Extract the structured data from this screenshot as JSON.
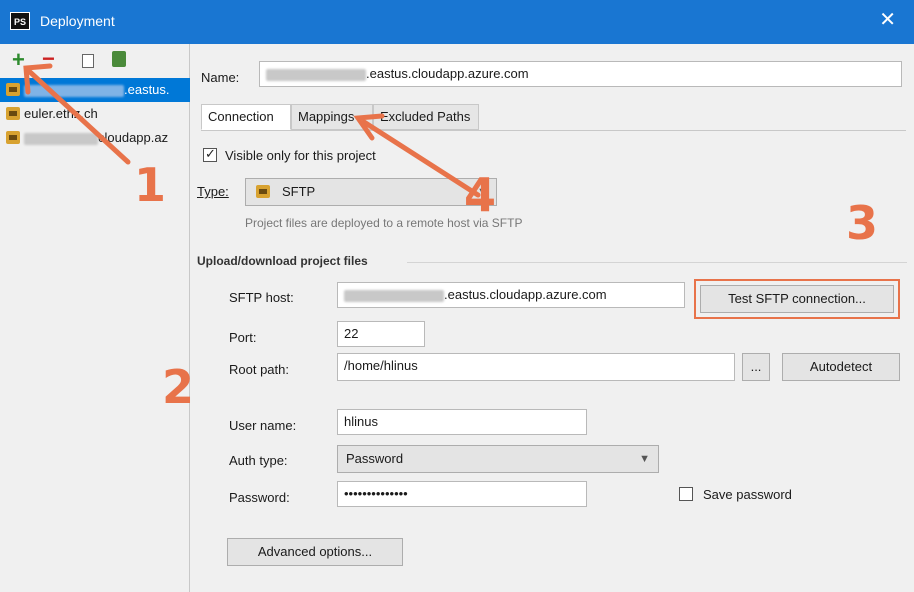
{
  "window": {
    "app_icon": "PS",
    "title": "Deployment",
    "close_glyph": "✕"
  },
  "toolbar": {
    "add_glyph": "+",
    "remove_glyph": "−"
  },
  "servers": [
    {
      "label": ".eastus.",
      "selected": true
    },
    {
      "label": "euler.ethz.ch",
      "selected": false
    },
    {
      "label": "cloudapp.az",
      "selected": false
    }
  ],
  "name": {
    "label": "Name:",
    "value_suffix": ".eastus.cloudapp.azure.com"
  },
  "tabs": [
    {
      "label": "Connection",
      "active": true
    },
    {
      "label": "Mappings",
      "active": false
    },
    {
      "label": "Excluded Paths",
      "active": false
    }
  ],
  "visible_only": {
    "label": "Visible only for this project",
    "checked": true
  },
  "type": {
    "label": "Type:",
    "value": "SFTP",
    "hint": "Project files are deployed to a remote host via SFTP"
  },
  "upload_section": {
    "title": "Upload/download project files"
  },
  "sftp_host": {
    "label": "SFTP host:",
    "value_suffix": ".eastus.cloudapp.azure.com"
  },
  "test_button": {
    "label": "Test SFTP connection..."
  },
  "port": {
    "label": "Port:",
    "value": "22"
  },
  "root_path": {
    "label": "Root path:",
    "value": "/home/hlinus"
  },
  "browse_button": {
    "label": "..."
  },
  "autodetect_button": {
    "label": "Autodetect"
  },
  "user_name": {
    "label": "User name:",
    "value": "hlinus"
  },
  "auth_type": {
    "label": "Auth type:",
    "value": "Password"
  },
  "password": {
    "label": "Password:",
    "value": "••••••••••••••"
  },
  "save_password": {
    "label": "Save password",
    "checked": false
  },
  "advanced_button": {
    "label": "Advanced options..."
  },
  "annotations": [
    "1",
    "2",
    "3",
    "4"
  ],
  "colors": {
    "titlebar": "#1976d2",
    "selection": "#0078d7",
    "annotation": "#e8734a"
  }
}
